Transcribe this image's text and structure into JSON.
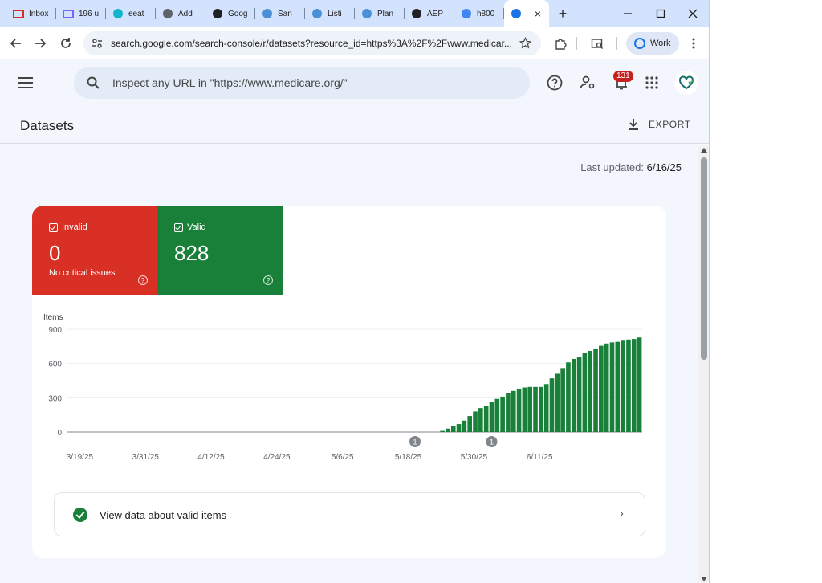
{
  "browser": {
    "tabs": [
      {
        "title": "Inbox",
        "icon": "gmail-icon",
        "color": "#d93025"
      },
      {
        "title": "196 u",
        "icon": "mail-icon",
        "color": "#7b61ff"
      },
      {
        "title": "eeat",
        "icon": "grid-icon",
        "color": "#12b5cb"
      },
      {
        "title": "Add",
        "icon": "globe-icon",
        "color": "#5f6368"
      },
      {
        "title": "Goog",
        "icon": "eye-icon",
        "color": "#202124"
      },
      {
        "title": "San",
        "icon": "medicare-icon",
        "color": "#4a90d9"
      },
      {
        "title": "Listi",
        "icon": "medicare-icon",
        "color": "#4a90d9"
      },
      {
        "title": "Plan",
        "icon": "medicare-icon",
        "color": "#4a90d9"
      },
      {
        "title": "AEP",
        "icon": "openai-icon",
        "color": "#202124"
      },
      {
        "title": "h800",
        "icon": "google-icon",
        "color": "#4285f4"
      },
      {
        "title": "",
        "icon": "search-console-icon",
        "color": "#1a73e8"
      }
    ],
    "new_tab_label": "+",
    "url": "search.google.com/search-console/r/datasets?resource_id=https%3A%2F%2Fwww.medicar...",
    "profile_label": "Work"
  },
  "header": {
    "search_placeholder": "Inspect any URL in \"https://www.medicare.org/\"",
    "notification_count": "131"
  },
  "page": {
    "title": "Datasets",
    "export_label": "EXPORT",
    "last_updated_label": "Last updated:",
    "last_updated_value": "6/16/25"
  },
  "summary": {
    "invalid": {
      "label": "Invalid",
      "value": "0",
      "sub": "No critical issues",
      "color": "#d93025"
    },
    "valid": {
      "label": "Valid",
      "value": "828",
      "color": "#188038"
    }
  },
  "chart_data": {
    "type": "bar",
    "ylabel": "Items",
    "ylim": [
      0,
      900
    ],
    "yticks": [
      "900",
      "600",
      "300",
      "0"
    ],
    "xtick_labels": [
      "3/19/25",
      "3/31/25",
      "4/12/25",
      "4/24/25",
      "5/6/25",
      "5/18/25",
      "5/30/25",
      "6/11/25"
    ],
    "first_date": "3/19/25",
    "series": [
      {
        "name": "Valid",
        "color": "#188038",
        "values": [
          0,
          0,
          0,
          0,
          0,
          0,
          0,
          0,
          0,
          0,
          0,
          0,
          0,
          0,
          0,
          0,
          0,
          0,
          0,
          0,
          0,
          0,
          0,
          0,
          0,
          0,
          0,
          0,
          0,
          0,
          0,
          0,
          0,
          0,
          0,
          0,
          0,
          0,
          0,
          0,
          0,
          0,
          0,
          0,
          0,
          0,
          0,
          0,
          0,
          0,
          0,
          0,
          0,
          0,
          0,
          0,
          0,
          0,
          0,
          0,
          0,
          0,
          0,
          0,
          0,
          0,
          0,
          0,
          10,
          30,
          50,
          70,
          100,
          140,
          180,
          210,
          230,
          260,
          290,
          310,
          340,
          360,
          380,
          390,
          395,
          395,
          395,
          420,
          470,
          510,
          560,
          610,
          640,
          660,
          690,
          710,
          730,
          755,
          775,
          785,
          790,
          800,
          810,
          815,
          828
        ]
      }
    ],
    "annotations": [
      {
        "label": "1",
        "date": "5/21/25"
      },
      {
        "label": "1",
        "date": "6/4/25"
      }
    ]
  },
  "valid_link": {
    "label": "View data about valid items"
  }
}
